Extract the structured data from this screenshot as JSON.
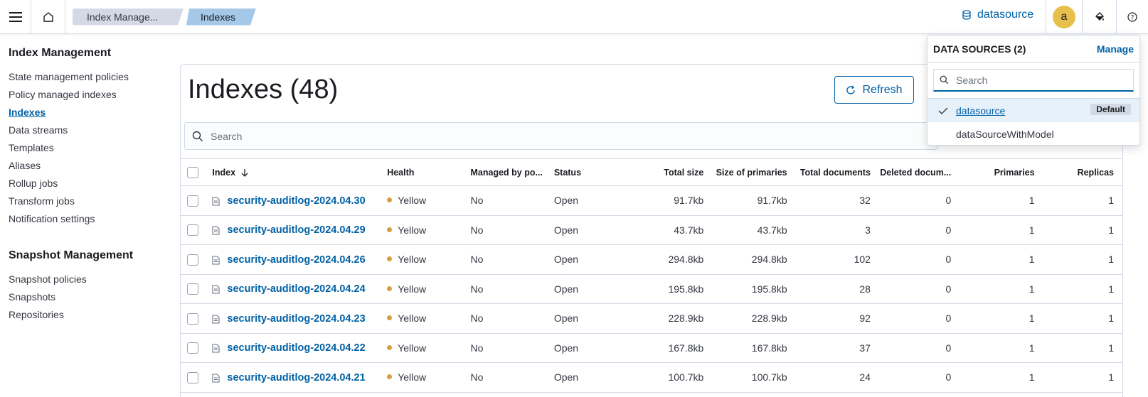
{
  "header": {
    "breadcrumbs": [
      "Index Manage...",
      "Indexes"
    ],
    "datasource_label": "datasource",
    "avatar_initial": "a"
  },
  "sidenav": {
    "index_title": "Index Management",
    "index_items": [
      "State management policies",
      "Policy managed indexes",
      "Indexes",
      "Data streams",
      "Templates",
      "Aliases",
      "Rollup jobs",
      "Transform jobs",
      "Notification settings"
    ],
    "active_item": "Indexes",
    "snapshot_title": "Snapshot Management",
    "snapshot_items": [
      "Snapshot policies",
      "Snapshots",
      "Repositories"
    ]
  },
  "main": {
    "title": "Indexes (48)",
    "refresh_label": "Refresh",
    "search_placeholder": "Search",
    "columns": [
      "Index",
      "Health",
      "Managed by po...",
      "Status",
      "Total size",
      "Size of primaries",
      "Total documents",
      "Deleted docum...",
      "Primaries",
      "Replicas"
    ],
    "rows": [
      {
        "index": "security-auditlog-2024.04.30",
        "health": "Yellow",
        "managed": "No",
        "status": "Open",
        "total_size": "91.7kb",
        "primary_size": "91.7kb",
        "total_docs": "32",
        "deleted_docs": "0",
        "primaries": "1",
        "replicas": "1"
      },
      {
        "index": "security-auditlog-2024.04.29",
        "health": "Yellow",
        "managed": "No",
        "status": "Open",
        "total_size": "43.7kb",
        "primary_size": "43.7kb",
        "total_docs": "3",
        "deleted_docs": "0",
        "primaries": "1",
        "replicas": "1"
      },
      {
        "index": "security-auditlog-2024.04.26",
        "health": "Yellow",
        "managed": "No",
        "status": "Open",
        "total_size": "294.8kb",
        "primary_size": "294.8kb",
        "total_docs": "102",
        "deleted_docs": "0",
        "primaries": "1",
        "replicas": "1"
      },
      {
        "index": "security-auditlog-2024.04.24",
        "health": "Yellow",
        "managed": "No",
        "status": "Open",
        "total_size": "195.8kb",
        "primary_size": "195.8kb",
        "total_docs": "28",
        "deleted_docs": "0",
        "primaries": "1",
        "replicas": "1"
      },
      {
        "index": "security-auditlog-2024.04.23",
        "health": "Yellow",
        "managed": "No",
        "status": "Open",
        "total_size": "228.9kb",
        "primary_size": "228.9kb",
        "total_docs": "92",
        "deleted_docs": "0",
        "primaries": "1",
        "replicas": "1"
      },
      {
        "index": "security-auditlog-2024.04.22",
        "health": "Yellow",
        "managed": "No",
        "status": "Open",
        "total_size": "167.8kb",
        "primary_size": "167.8kb",
        "total_docs": "37",
        "deleted_docs": "0",
        "primaries": "1",
        "replicas": "1"
      },
      {
        "index": "security-auditlog-2024.04.21",
        "health": "Yellow",
        "managed": "No",
        "status": "Open",
        "total_size": "100.7kb",
        "primary_size": "100.7kb",
        "total_docs": "24",
        "deleted_docs": "0",
        "primaries": "1",
        "replicas": "1"
      }
    ]
  },
  "datasource_popover": {
    "title": "DATA SOURCES (2)",
    "manage_label": "Manage",
    "search_placeholder": "Search",
    "items": [
      {
        "name": "datasource",
        "selected": true,
        "badge": "Default"
      },
      {
        "name": "dataSourceWithModel",
        "selected": false
      }
    ]
  },
  "colors": {
    "link": "#0061a6",
    "health_yellow": "#d6a03f",
    "avatar_bg": "#e7c04b",
    "active_crumb": "#a6c8e8"
  },
  "icons": [
    "menu-icon",
    "home-icon",
    "database-icon",
    "paint-icon",
    "help-icon",
    "refresh-icon",
    "search-icon",
    "sort-down-icon",
    "document-icon",
    "check-icon"
  ]
}
